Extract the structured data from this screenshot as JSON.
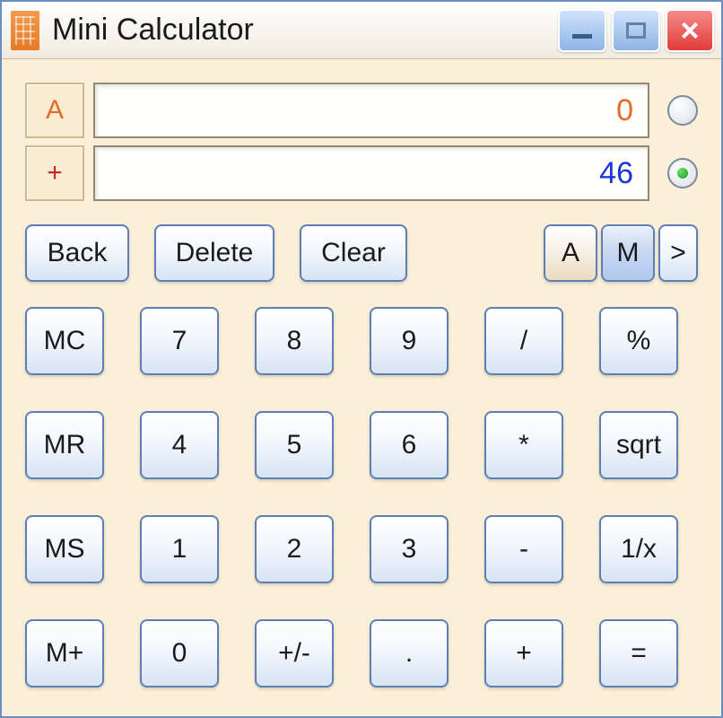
{
  "window": {
    "title": "Mini Calculator"
  },
  "display": {
    "rowA": {
      "opLabel": "A",
      "value": "0",
      "selected": false
    },
    "rowB": {
      "opLabel": "+",
      "value": "46",
      "selected": true
    }
  },
  "toolbar": {
    "back": "Back",
    "delete": "Delete",
    "clear": "Clear",
    "modeA": "A",
    "modeM": "M",
    "more": ">"
  },
  "keys": {
    "mc": "MC",
    "mr": "MR",
    "ms": "MS",
    "mplus": "M+",
    "k7": "7",
    "k8": "8",
    "k9": "9",
    "k4": "4",
    "k5": "5",
    "k6": "6",
    "k1": "1",
    "k2": "2",
    "k3": "3",
    "k0": "0",
    "neg": "+/-",
    "dot": ".",
    "div": "/",
    "mul": "*",
    "sub": "-",
    "add": "+",
    "pct": "%",
    "sqrt": "sqrt",
    "inv": "1/x",
    "eq": "="
  }
}
